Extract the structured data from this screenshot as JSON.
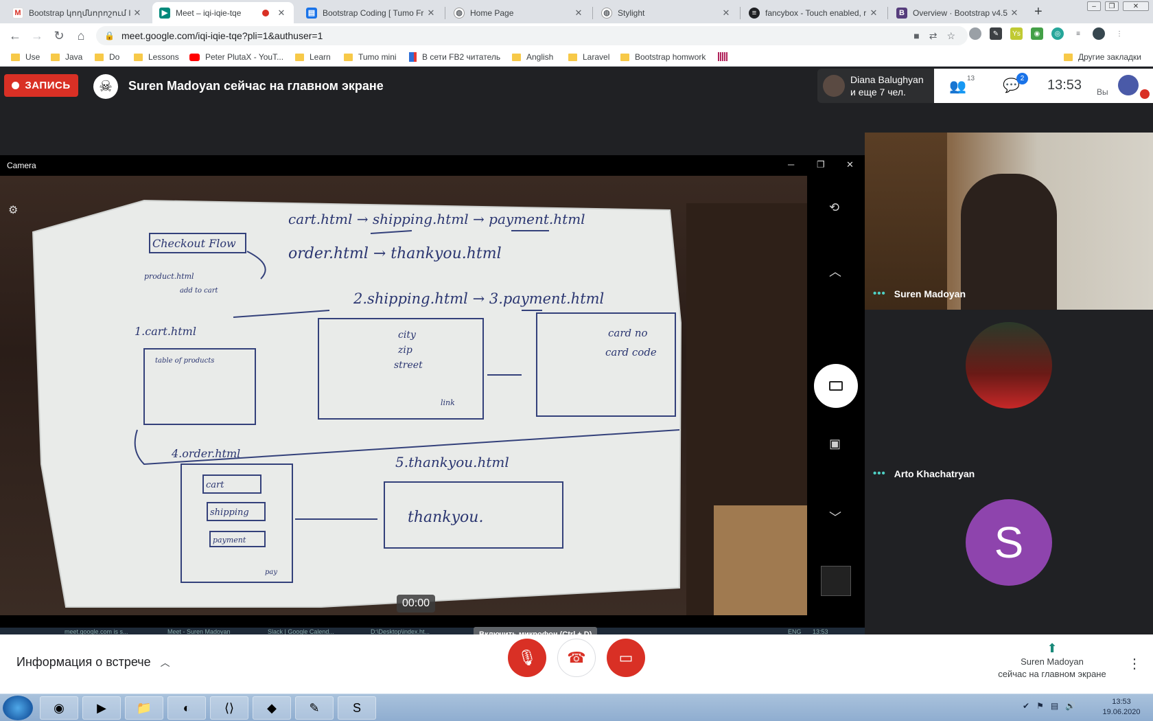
{
  "browser": {
    "tabs": [
      {
        "title": "Bootstrap կողմնորոշում I - a",
        "favicon": "gmail-icon",
        "color": "#d93025",
        "active": false
      },
      {
        "title": "Meet – iqi-iqie-tqe",
        "favicon": "meet-icon",
        "color": "#00897b",
        "active": true
      },
      {
        "title": "Bootstrap Coding [ Tumo Fr",
        "favicon": "docs-icon",
        "color": "#1a73e8",
        "active": false
      },
      {
        "title": "Home Page",
        "favicon": "globe-icon",
        "color": "#5f6368",
        "active": false
      },
      {
        "title": "Stylight",
        "favicon": "globe-icon",
        "color": "#5f6368",
        "active": false
      },
      {
        "title": "fancybox - Touch enabled, r",
        "favicon": "fancybox-icon",
        "color": "#202124",
        "active": false
      },
      {
        "title": "Overview · Bootstrap v4.5",
        "favicon": "bootstrap-icon",
        "color": "#563d7c",
        "active": false
      }
    ],
    "new_tab_label": "+",
    "address": "meet.google.com/iqi-iqie-tqe?pli=1&authuser=1",
    "bookmarks": [
      {
        "label": "Use",
        "type": "folder"
      },
      {
        "label": "Java",
        "type": "folder"
      },
      {
        "label": "Do",
        "type": "folder"
      },
      {
        "label": "Lessons",
        "type": "folder"
      },
      {
        "label": "Peter PlutaX - YouT...",
        "type": "youtube"
      },
      {
        "label": "Learn",
        "type": "folder"
      },
      {
        "label": "Tumo mini",
        "type": "folder"
      },
      {
        "label": "В сети FB2 читатель",
        "type": "book"
      },
      {
        "label": "Anglish",
        "type": "folder"
      },
      {
        "label": "Laravel",
        "type": "folder"
      },
      {
        "label": "Bootstrap homwork",
        "type": "folder"
      }
    ],
    "other_bookmarks": "Другие закладки"
  },
  "meet": {
    "recording_label": "ЗАПИСЬ",
    "presenting_title": "Suren Madoyan сейчас на главном экране",
    "join_info": {
      "line1": "Diana Balughyan",
      "line2": "и еще 7 чел."
    },
    "people_count": "13",
    "chat_badge": "2",
    "time": "13:53",
    "you_label": "Вы",
    "shared_window": {
      "title": "Camera",
      "timer": "00:00",
      "whiteboard_lines": [
        "Checkout Flow",
        "cart.html → shipping.html → payment.html",
        "order.html → thankyou.html",
        "product.html",
        "add to cart",
        "2.shipping.html → 3.payment.html",
        "1.cart.html",
        "table of products",
        "city",
        "zip",
        "street",
        "card no",
        "card code",
        "link",
        "4.order.html",
        "5.thankyou.html",
        "cart",
        "shipping",
        "payment",
        "pay",
        "thankyou."
      ],
      "inner_taskbar": [
        "meet.google.com is s...",
        "Meet - Suren Madoyan",
        "Slack | Google Calend...",
        "D:\\Desktop\\index.ht...",
        "ENG",
        "13:53"
      ]
    },
    "participants": [
      {
        "name": "Suren Madoyan",
        "kind": "video"
      },
      {
        "name": "Arto Khachatryan",
        "kind": "photo"
      },
      {
        "name": "",
        "kind": "letter",
        "letter": "S",
        "color": "#8e44ad"
      }
    ],
    "bottom": {
      "meeting_info": "Информация о встрече",
      "mic_tooltip": "Включить микрофон (Ctrl + D)",
      "presenting_line1": "Suren Madoyan",
      "presenting_line2": "сейчас на главном экране"
    }
  },
  "taskbar": {
    "clock_time": "13:53",
    "clock_date": "19.06.2020"
  }
}
